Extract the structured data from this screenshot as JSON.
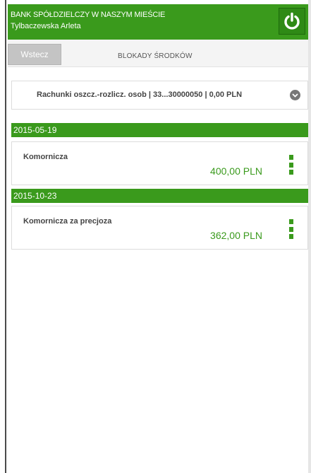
{
  "header": {
    "bank_name": "BANK SPÓŁDZIELCZY W NASZYM MIEŚCIE",
    "user_name": "Tylbaczewska Arleta",
    "power_icon": "power-icon"
  },
  "toolbar": {
    "back_label": "Wstecz",
    "title": "BLOKADY ŚRODKÓW"
  },
  "account": {
    "selected": "Rachunki oszcz.-rozlicz. osob | 33...30000050 | 0,00 PLN",
    "chevron_icon": "chevron-down-icon"
  },
  "blocks": [
    {
      "date": "2015-05-19",
      "title": "Komornicza",
      "amount": "400,00 PLN",
      "menu_icon": "kebab-menu-icon"
    },
    {
      "date": "2015-10-23",
      "title": "Komornicza za precjoza",
      "amount": "362,00 PLN",
      "menu_icon": "kebab-menu-icon"
    }
  ],
  "colors": {
    "brand_green": "#3a9a1c",
    "back_button_gray": "#c4c4c4"
  }
}
